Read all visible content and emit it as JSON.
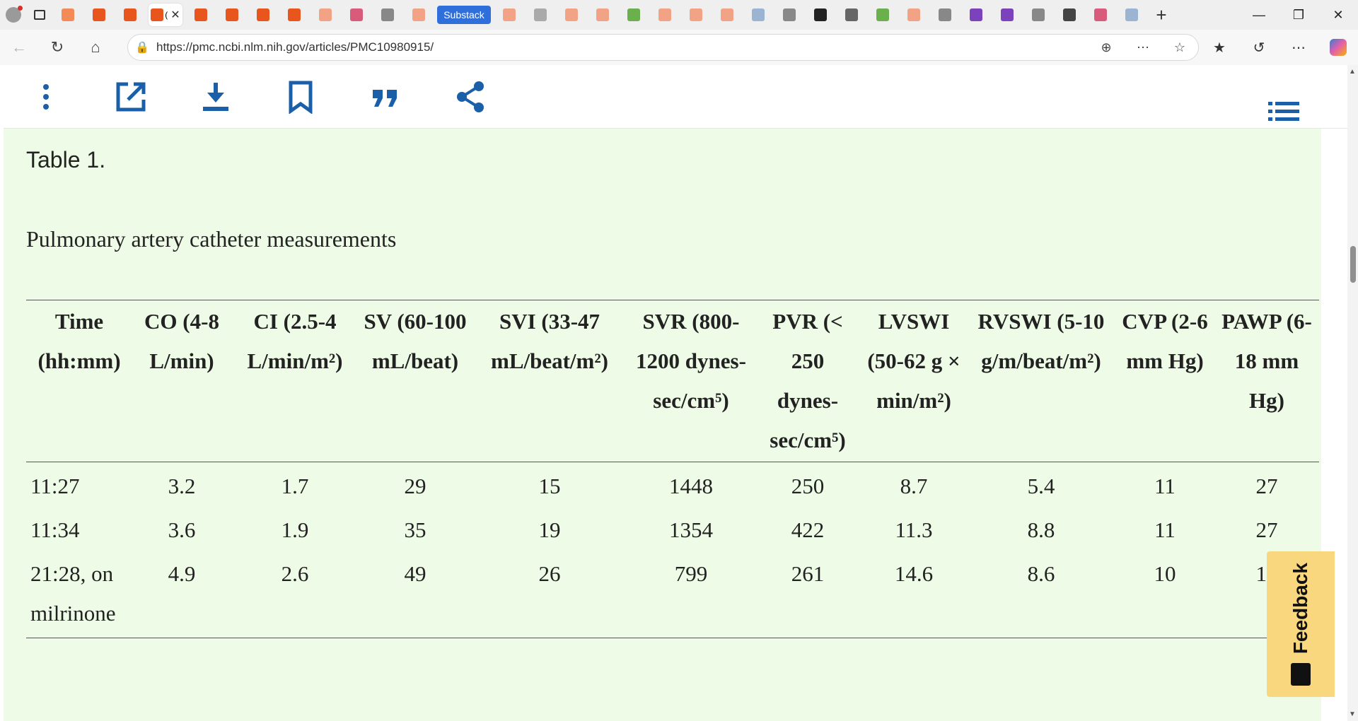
{
  "browser": {
    "active_tab_title": "(",
    "substack_tab_label": "Substack",
    "url": "https://pmc.ncbi.nlm.nih.gov/articles/PMC10980915/",
    "favicons": [
      "#f28b57",
      "#e8551d",
      "#e8551d",
      "#e8551d",
      "#e8551d",
      "#e8551d",
      "#e8551d",
      "#f2a285",
      "#d95b7c",
      "#888888",
      "#f2a285",
      "#f2a285",
      "#aaaaaa",
      "#f2a285",
      "#f2a285",
      "#6ab04c",
      "#f2a285",
      "#f2a285",
      "#f2a285",
      "#9bb4d1",
      "#888888",
      "#222222",
      "#666666",
      "#6ab04c",
      "#f2a285",
      "#888888",
      "#7b42bc",
      "#7b42bc",
      "#888888",
      "#444444",
      "#d95b7c",
      "#9bb4d1"
    ]
  },
  "article_toolbar": {
    "icons": [
      "more-vertical-icon",
      "open-external-icon",
      "download-icon",
      "bookmark-icon",
      "cite-quote-icon",
      "share-icon",
      "table-of-contents-icon"
    ]
  },
  "table": {
    "label": "Table 1.",
    "caption": "Pulmonary artery catheter measurements",
    "headers": [
      "Time (hh:mm)",
      "CO (4-8 L/min)",
      "CI (2.5-4 L/min/m²)",
      "SV (60-100 mL/beat)",
      "SVI (33-47 mL/beat/m²)",
      "SVR (800-1200 dynes-sec/cm⁵)",
      "PVR (< 250 dynes-sec/cm⁵)",
      "LVSWI (50-62 g × min/m²)",
      "RVSWI (5-10 g/m/beat/m²)",
      "CVP (2-6 mm Hg)",
      "PAWP (6-18 mm Hg)"
    ],
    "rows": [
      [
        "11:27",
        "3.2",
        "1.7",
        "29",
        "15",
        "1448",
        "250",
        "8.7",
        "5.4",
        "11",
        "27"
      ],
      [
        "11:34",
        "3.6",
        "1.9",
        "35",
        "19",
        "1354",
        "422",
        "11.3",
        "8.8",
        "11",
        "27"
      ],
      [
        "21:28, on milrinone",
        "4.9",
        "2.6",
        "49",
        "26",
        "799",
        "261",
        "14.6",
        "8.6",
        "10",
        "18"
      ]
    ]
  },
  "feedback_label": "Feedback",
  "open_new_tab_label": "Open in a new tab",
  "colors": {
    "ncbi_blue": "#1a5fa8",
    "table_background": "#eefbe6",
    "feedback_background": "#f9d77e"
  }
}
